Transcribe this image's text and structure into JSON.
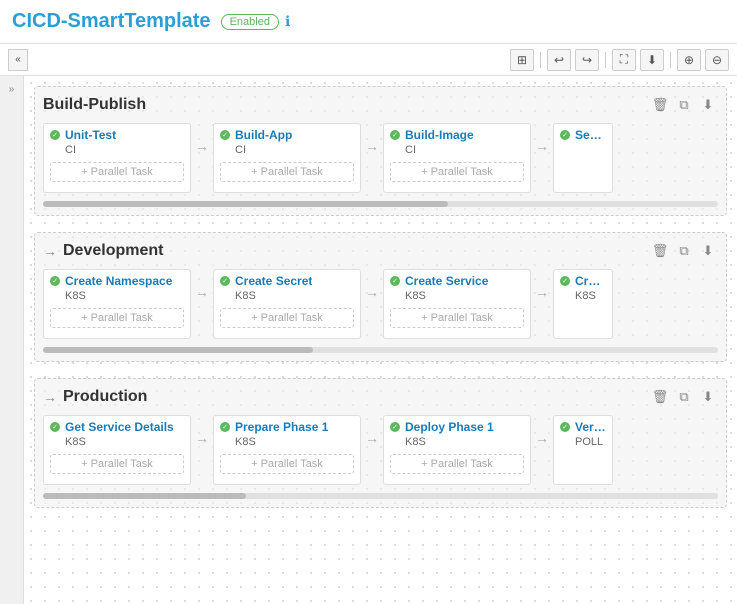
{
  "header": {
    "title": "CICD-SmartTemplate",
    "badge": "Enabled",
    "info_icon": "ℹ"
  },
  "toolbar": {
    "grid_icon": "⊞",
    "undo_icon": "↩",
    "redo_icon": "↪",
    "image_icon": "🖼",
    "download_icon": "⬇",
    "zoom_in_icon": "⊕",
    "zoom_out_icon": "⊖",
    "collapse_icon": "«"
  },
  "stages": [
    {
      "id": "build-publish",
      "title": "Build-Publish",
      "has_arrow": false,
      "tasks": [
        {
          "name": "Unit-Test",
          "type": "CI",
          "status": "success"
        },
        {
          "name": "Build-App",
          "type": "CI",
          "status": "success"
        },
        {
          "name": "Build-Image",
          "type": "CI",
          "status": "success"
        },
        {
          "name": "Sequ...",
          "type": "",
          "status": "success",
          "partial": true
        }
      ],
      "scroll_width": "60%"
    },
    {
      "id": "development",
      "title": "Development",
      "has_arrow": true,
      "tasks": [
        {
          "name": "Create Namespace",
          "type": "K8S",
          "status": "success"
        },
        {
          "name": "Create Secret",
          "type": "K8S",
          "status": "success"
        },
        {
          "name": "Create Service",
          "type": "K8S",
          "status": "success"
        },
        {
          "name": "Crea...",
          "type": "K8S",
          "status": "success",
          "partial": true
        }
      ],
      "scroll_width": "40%"
    },
    {
      "id": "production",
      "title": "Production",
      "has_arrow": true,
      "tasks": [
        {
          "name": "Get Service Details",
          "type": "K8S",
          "status": "success"
        },
        {
          "name": "Prepare Phase 1",
          "type": "K8S",
          "status": "success"
        },
        {
          "name": "Deploy Phase 1",
          "type": "K8S",
          "status": "success"
        },
        {
          "name": "Veri...",
          "type": "POLL",
          "status": "success",
          "partial": true
        }
      ],
      "scroll_width": "30%"
    }
  ],
  "add_parallel_label": "+ Parallel Task",
  "stage_actions": {
    "delete_icon": "🗑",
    "copy_icon": "⧉",
    "download_icon": "⬇"
  }
}
